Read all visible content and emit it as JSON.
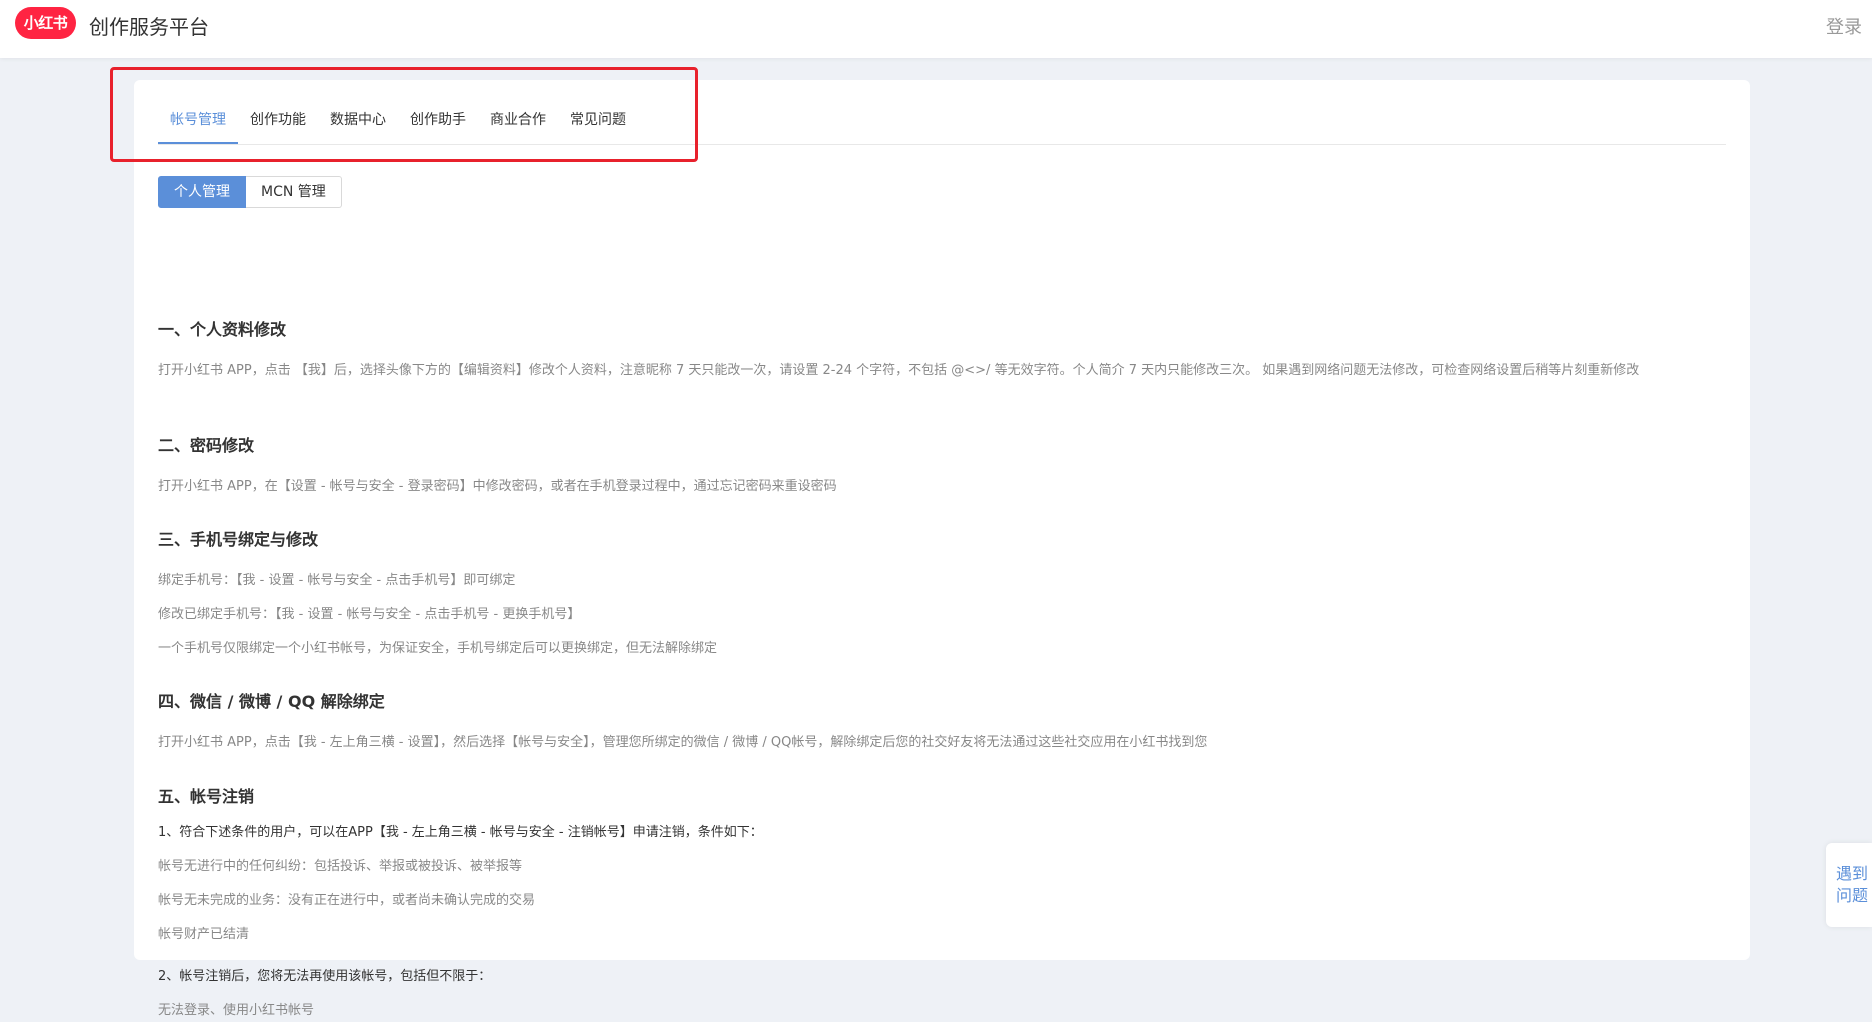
{
  "header": {
    "logo_text": "小红书",
    "title": "创作服务平台",
    "login_label": "登录"
  },
  "tabs": [
    {
      "label": "帐号管理",
      "active": true
    },
    {
      "label": "创作功能"
    },
    {
      "label": "数据中心"
    },
    {
      "label": "创作助手"
    },
    {
      "label": "商业合作"
    },
    {
      "label": "常见问题"
    }
  ],
  "subtabs": [
    {
      "label": "个人管理",
      "active": true
    },
    {
      "label": "MCN 管理"
    }
  ],
  "sections": {
    "s1_title": "一、个人资料修改",
    "s1_p1": "打开小红书 APP，点击 【我】后，选择头像下方的【编辑资料】修改个人资料，注意昵称 7 天只能改一次，请设置 2-24 个字符，不包括 @<>/ 等无效字符。个人简介 7 天内只能修改三次。 如果遇到网络问题无法修改，可检查网络设置后稍等片刻重新修改",
    "s2_title": "二、密码修改",
    "s2_p1": "打开小红书 APP，在【设置 - 帐号与安全 - 登录密码】中修改密码，或者在手机登录过程中，通过忘记密码来重设密码",
    "s3_title": "三、手机号绑定与修改",
    "s3_p1": "绑定手机号：【我 - 设置 - 帐号与安全 - 点击手机号】即可绑定",
    "s3_p2": "修改已绑定手机号：【我 - 设置 - 帐号与安全 - 点击手机号 - 更换手机号】",
    "s3_p3": "一个手机号仅限绑定一个小红书帐号，为保证安全，手机号绑定后可以更换绑定，但无法解除绑定",
    "s4_title": "四、微信 / 微博 / QQ 解除绑定",
    "s4_p1": "打开小红书 APP，点击【我 - 左上角三横 - 设置】，然后选择【帐号与安全】，管理您所绑定的微信 / 微博 / QQ帐号，解除绑定后您的社交好友将无法通过这些社交应用在小红书找到您",
    "s5_title": "五、帐号注销",
    "s5_p1": "1、符合下述条件的用户，可以在APP【我 - 左上角三横 - 帐号与安全 - 注销帐号】申请注销，条件如下：",
    "s5_p2": "帐号无进行中的任何纠纷：包括投诉、举报或被投诉、被举报等",
    "s5_p3": "帐号无未完成的业务：没有正在进行中，或者尚未确认完成的交易",
    "s5_p4": "帐号财产已结清",
    "s5_p5": "2、帐号注销后，您将无法再使用该帐号，包括但不限于：",
    "s5_p6": "无法登录、使用小红书帐号"
  },
  "help_float": {
    "line1": "遇到",
    "line2": "问题"
  },
  "colors": {
    "accent": "#5b8fd9",
    "brand": "#ff2442",
    "highlight": "#e8212c"
  }
}
